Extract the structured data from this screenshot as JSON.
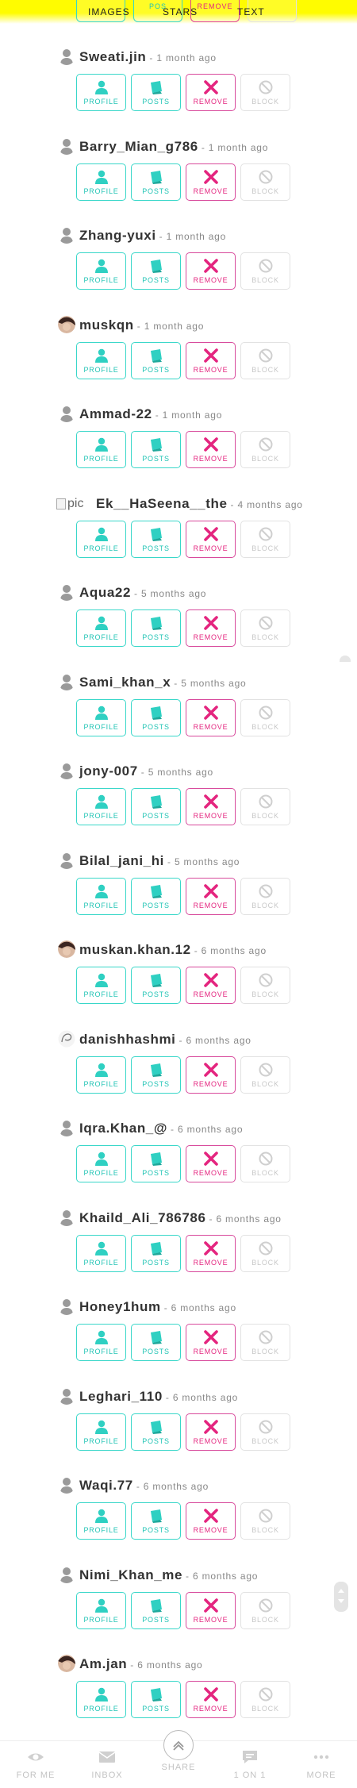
{
  "top_tabs": [
    {
      "label": "IMAGES"
    },
    {
      "label": "STARS"
    },
    {
      "label": "TEXT"
    }
  ],
  "top_tab_fragments": {
    "posts_fragment": "POS",
    "remove_fragment": "REMOVE"
  },
  "actions": {
    "profile": "PROFILE",
    "posts": "POSTS",
    "remove": "REMOVE",
    "block": "BLOCK"
  },
  "broken_image_alt": "pic",
  "users": [
    {
      "username": "Sweati.jin",
      "time": "- 1 month ago",
      "avatar": "default-avatar-icon"
    },
    {
      "username": "Barry_Mian_g786",
      "time": "- 1 month ago",
      "avatar": "default-avatar-icon"
    },
    {
      "username": "Zhang-yuxi",
      "time": "- 1 month ago",
      "avatar": "default-avatar-icon"
    },
    {
      "username": "muskqn",
      "time": "- 1 month ago",
      "avatar": "photo-avatar"
    },
    {
      "username": "Ammad-22",
      "time": "- 1 month ago",
      "avatar": "default-avatar-icon"
    },
    {
      "username": "Ek__HaSeena__the",
      "time": "- 4 months ago",
      "avatar": "broken-image"
    },
    {
      "username": "Aqua22",
      "time": "- 5 months ago",
      "avatar": "default-avatar-icon"
    },
    {
      "username": "Sami_khan_x",
      "time": "- 5 months ago",
      "avatar": "default-avatar-icon"
    },
    {
      "username": "jony-007",
      "time": "- 5 months ago",
      "avatar": "default-avatar-icon"
    },
    {
      "username": "Bilal_jani_hi",
      "time": "- 5 months ago",
      "avatar": "default-avatar-icon"
    },
    {
      "username": "muskan.khan.12",
      "time": "- 6 months ago",
      "avatar": "photo-avatar"
    },
    {
      "username": "danishhashmi",
      "time": "- 6 months ago",
      "avatar": "sketch-avatar"
    },
    {
      "username": "Iqra.Khan_@",
      "time": "- 6 months ago",
      "avatar": "default-avatar-icon"
    },
    {
      "username": "Khaild_Ali_786786",
      "time": "- 6 months ago",
      "avatar": "default-avatar-icon"
    },
    {
      "username": "Honey1hum",
      "time": "- 6 months ago",
      "avatar": "default-avatar-icon"
    },
    {
      "username": "Leghari_110",
      "time": "- 6 months ago",
      "avatar": "default-avatar-icon"
    },
    {
      "username": "Waqi.77",
      "time": "- 6 months ago",
      "avatar": "default-avatar-icon"
    },
    {
      "username": "Nimi_Khan_me",
      "time": "- 6 months ago",
      "avatar": "default-avatar-icon"
    },
    {
      "username": "Am.jan",
      "time": "- 6 months ago",
      "avatar": "photo-avatar"
    }
  ],
  "bottom_nav": [
    {
      "label": "FOR ME",
      "icon": "eye-icon"
    },
    {
      "label": "INBOX",
      "icon": "envelope-icon"
    },
    {
      "label": "SHARE",
      "icon": "share-arrow-icon"
    },
    {
      "label": "1 ON 1",
      "icon": "chat-bubble-icon"
    },
    {
      "label": "MORE",
      "icon": "more-dots-icon"
    }
  ],
  "colors": {
    "accent_teal": "#39d7c9",
    "remove_pink": "#e4257f",
    "top_bar_yellow": "#fffc00",
    "block_gray": "#c8c8c8"
  }
}
